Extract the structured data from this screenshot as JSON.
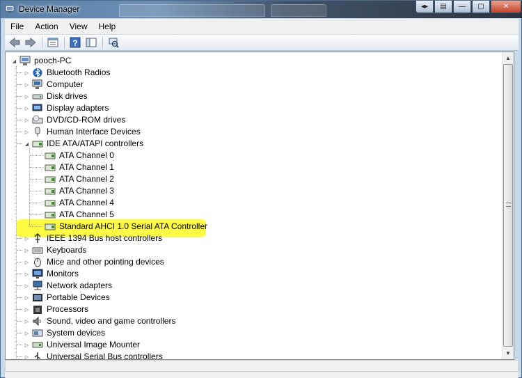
{
  "window": {
    "title": "Device Manager",
    "background_tabs": [
      "",
      "",
      ""
    ]
  },
  "menu": [
    "File",
    "Action",
    "View",
    "Help"
  ],
  "toolbar": {
    "buttons": [
      "back-icon",
      "forward-icon",
      "properties-icon",
      "help-icon",
      "show-hide-tree-icon",
      "scan-hardware-icon"
    ]
  },
  "tree": {
    "root": "pooch-PC",
    "categories": [
      {
        "label": "Bluetooth Radios",
        "icon": "bluetooth-icon"
      },
      {
        "label": "Computer",
        "icon": "computer-icon"
      },
      {
        "label": "Disk drives",
        "icon": "disk-drive-icon"
      },
      {
        "label": "Display adapters",
        "icon": "display-adapter-icon"
      },
      {
        "label": "DVD/CD-ROM drives",
        "icon": "dvd-drive-icon"
      },
      {
        "label": "Human Interface Devices",
        "icon": "hid-icon"
      },
      {
        "label": "IDE ATA/ATAPI controllers",
        "icon": "ide-controller-icon",
        "expanded": true,
        "children": [
          "ATA Channel 0",
          "ATA Channel 1",
          "ATA Channel 2",
          "ATA Channel 3",
          "ATA Channel 4",
          "ATA Channel 5",
          "Standard AHCI 1.0 Serial ATA Controller"
        ]
      },
      {
        "label": "IEEE 1394 Bus host controllers",
        "icon": "firewire-icon"
      },
      {
        "label": "Keyboards",
        "icon": "keyboard-icon"
      },
      {
        "label": "Mice and other pointing devices",
        "icon": "mouse-icon"
      },
      {
        "label": "Monitors",
        "icon": "monitor-icon"
      },
      {
        "label": "Network adapters",
        "icon": "network-adapter-icon"
      },
      {
        "label": "Portable Devices",
        "icon": "portable-device-icon"
      },
      {
        "label": "Processors",
        "icon": "processor-icon"
      },
      {
        "label": "Sound, video and game controllers",
        "icon": "sound-icon"
      },
      {
        "label": "System devices",
        "icon": "system-devices-icon"
      },
      {
        "label": "Universal Image Mounter",
        "icon": "image-mounter-icon"
      },
      {
        "label": "Universal Serial Bus controllers",
        "icon": "usb-icon"
      }
    ]
  },
  "highlight_color": "#fffb3a",
  "colors": {
    "title_gradient_start": "#5a7fa7",
    "title_gradient_end": "#2c3340",
    "close_button": "#c4422a"
  }
}
